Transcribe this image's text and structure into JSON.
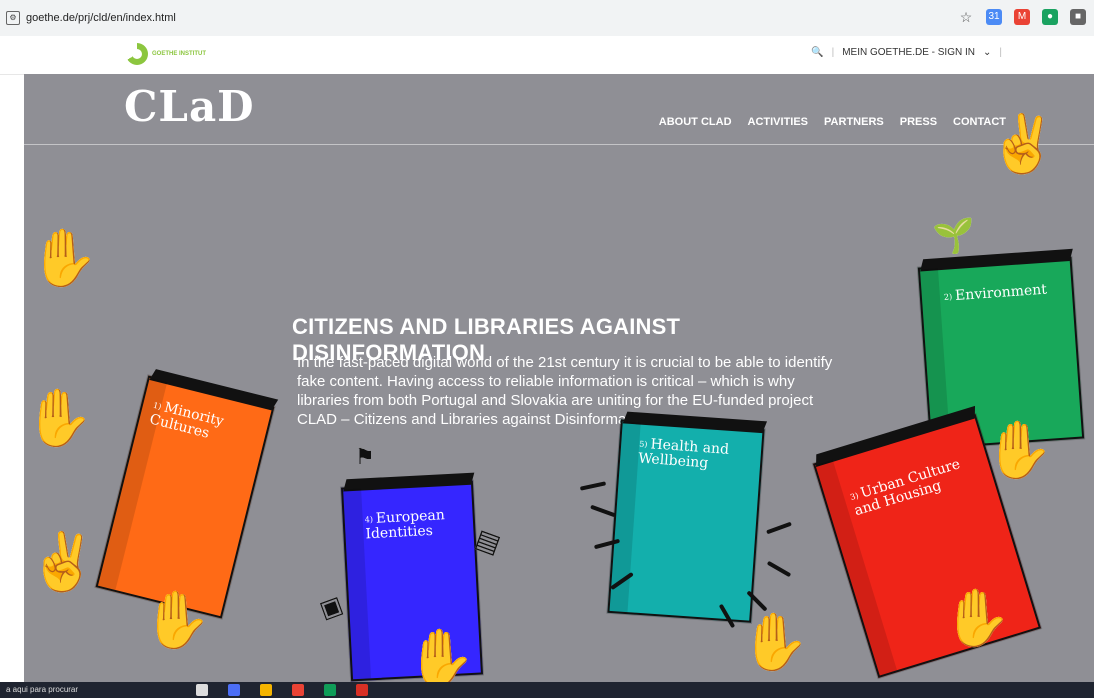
{
  "browser": {
    "url": "goethe.de/prj/cld/en/index.html",
    "icons": [
      "star-icon",
      "calendar-icon",
      "gmail-icon",
      "app-icon",
      "app-icon"
    ]
  },
  "goethe_bar": {
    "logo_text": "GOETHE INSTITUT",
    "search_label": "",
    "account_label": "MEIN GOETHE.DE - SIGN IN"
  },
  "hero": {
    "brand": "CLaD",
    "nav": [
      "ABOUT CLAD",
      "ACTIVITIES",
      "PARTNERS",
      "PRESS",
      "CONTACT"
    ],
    "title": "CITIZENS AND LIBRARIES AGAINST DISINFORMATION",
    "text": "In the fast-paced digital world of the 21st century it is crucial to be able to identify fake content. Having access to reliable information is critical – which is why libraries from both Portugal and Slovakia are uniting for the EU-funded project CLAD – Citizens and Libraries against Disinformation."
  },
  "books": [
    {
      "num": "1)",
      "title": "Minority Cultures",
      "color": "#ff6a16"
    },
    {
      "num": "2)",
      "title": "Environment",
      "color": "#18a85a"
    },
    {
      "num": "3)",
      "title": "Urban Culture and Housing",
      "color": "#ef2418"
    },
    {
      "num": "4)",
      "title": "European Identities",
      "color": "#3526ff"
    },
    {
      "num": "5)",
      "title": "Health and Wellbeing",
      "color": "#13afac"
    }
  ],
  "taskbar": {
    "search_text": "a aqui para procurar"
  }
}
